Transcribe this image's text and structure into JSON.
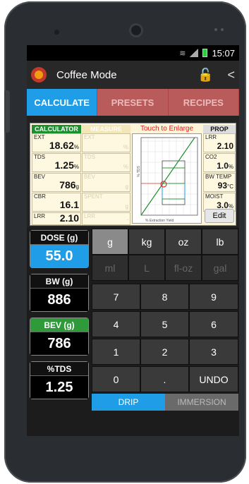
{
  "status": {
    "time": "15:07"
  },
  "actionbar": {
    "title": "Coffee Mode",
    "lock_icon": "lock-icon",
    "share_icon": "share-icon"
  },
  "tabs": [
    {
      "label": "CALCULATE",
      "active": true
    },
    {
      "label": "PRESETS",
      "active": false
    },
    {
      "label": "RECIPES",
      "active": false
    }
  ],
  "calculator": {
    "header_calc": "CALCULATOR",
    "header_measure": "MEASURE",
    "enlarge": "Touch to Enlarge",
    "header_prop": "PROP",
    "left": [
      {
        "label": "EXT",
        "value": "18.62",
        "unit": "%"
      },
      {
        "label": "TDS",
        "value": "1.25",
        "unit": "%"
      },
      {
        "label": "BEV",
        "value": "786",
        "unit": "g"
      },
      {
        "label": "CBR",
        "value": "16.1",
        "unit": ""
      },
      {
        "label": "LRR",
        "value": "2.10",
        "unit": ""
      }
    ],
    "measure": [
      {
        "label": "EXT",
        "value": "",
        "unit": "%"
      },
      {
        "label": "TDS",
        "value": "",
        "unit": "%"
      },
      {
        "label": "BEV",
        "value": "",
        "unit": "g"
      },
      {
        "label": "SPENT",
        "value": "",
        "unit": "g"
      },
      {
        "label": "LRR",
        "value": "",
        "unit": "-"
      }
    ],
    "prop": [
      {
        "label": "LRR",
        "value": "2.10",
        "unit": ""
      },
      {
        "label": "CO2",
        "value": "1.0",
        "unit": "%"
      },
      {
        "label": "BW TEMP",
        "value": "93",
        "unit": "°C"
      },
      {
        "label": "MOIST",
        "value": "3.0",
        "unit": "%"
      }
    ],
    "edit": "Edit",
    "graph": {
      "xlabel": "% Extraction Yield",
      "ylabel": "% TDS"
    }
  },
  "fields": {
    "dose": {
      "label": "DOSE (g)",
      "value": "55.0"
    },
    "bw": {
      "label": "BW (g)",
      "value": "886"
    },
    "bev": {
      "label": "BEV (g)",
      "value": "786"
    },
    "tds": {
      "label": "%TDS",
      "value": "1.25"
    }
  },
  "keypad": {
    "units": [
      "g",
      "kg",
      "oz",
      "lb",
      "ml",
      "L",
      "fl-oz",
      "gal"
    ],
    "digits": [
      "7",
      "8",
      "9",
      "4",
      "5",
      "6",
      "1",
      "2",
      "3",
      "0",
      ".",
      "UNDO"
    ],
    "modes": [
      "DRIP",
      "IMMERSION"
    ]
  },
  "colors": {
    "accent": "#1f9de6",
    "tab_inactive": "#b95b5b",
    "bev_green": "#2e9a3a"
  }
}
